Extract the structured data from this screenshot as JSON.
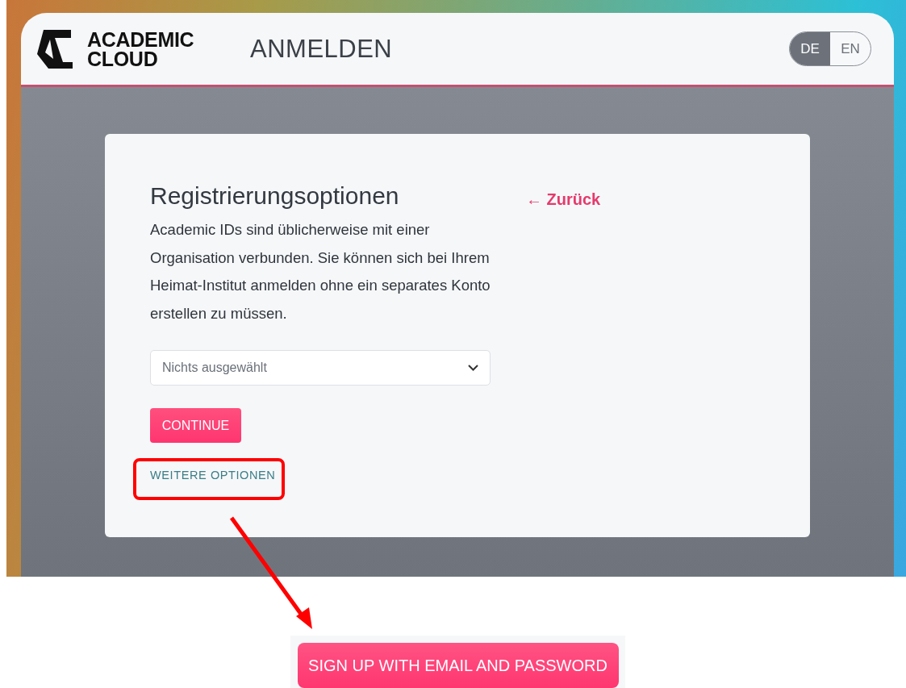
{
  "header": {
    "logo_text": "ACADEMIC CLOUD",
    "title": "ANMELDEN",
    "languages": [
      {
        "label": "DE",
        "selected": true
      },
      {
        "label": "EN",
        "selected": false
      }
    ]
  },
  "card": {
    "title": "Registrierungsoptionen",
    "back_link": "← Zurück",
    "description": "Academic IDs sind üblicherweise mit einer Organisation verbunden. Sie können sich bei Ihrem Heimat-Institut anmelden ohne ein separates Konto erstellen zu müssen.",
    "select": {
      "placeholder": "Nichts ausgewählt"
    },
    "continue_button": "CONTINUE",
    "more_options_link": "WEITERE OPTIONEN"
  },
  "callout": {
    "button": "SIGN UP WITH EMAIL AND PASSWORD"
  }
}
